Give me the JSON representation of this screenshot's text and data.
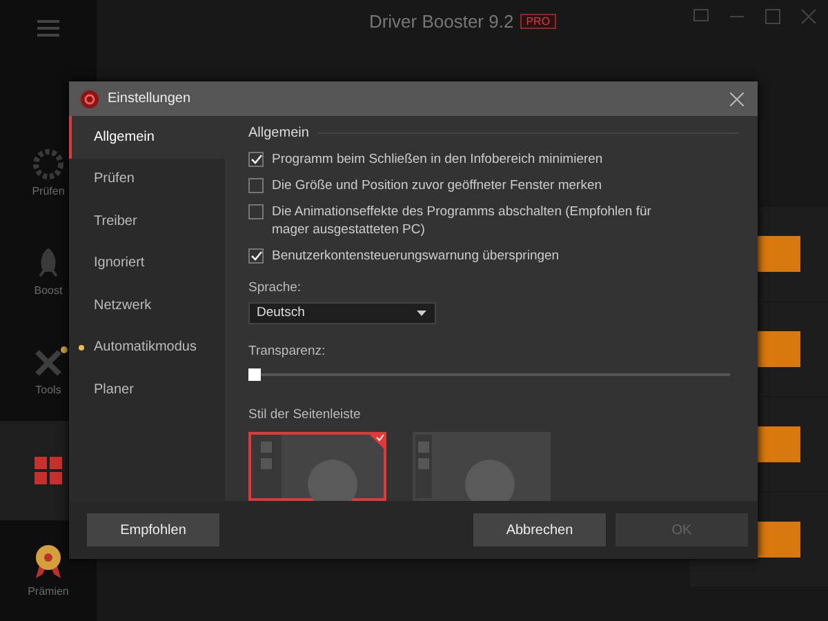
{
  "app": {
    "title": "Driver Booster 9.2",
    "badge": "PRO",
    "sidebar": [
      {
        "kind": "scan",
        "label": "Prüfen",
        "selected": false
      },
      {
        "kind": "boost",
        "label": "Boost",
        "selected": false
      },
      {
        "kind": "tools",
        "label": "Tools",
        "selected": false,
        "notification": true
      },
      {
        "kind": "action",
        "selected": true
      },
      {
        "kind": "rewards",
        "label": "Prämien",
        "selected": false
      }
    ]
  },
  "dialog": {
    "title": "Einstellungen",
    "nav": [
      {
        "label": "Allgemein",
        "selected": true,
        "notification": false
      },
      {
        "label": "Prüfen",
        "selected": false,
        "notification": false
      },
      {
        "label": "Treiber",
        "selected": false,
        "notification": false
      },
      {
        "label": "Ignoriert",
        "selected": false,
        "notification": false
      },
      {
        "label": "Netzwerk",
        "selected": false,
        "notification": false
      },
      {
        "label": "Automatikmodus",
        "selected": false,
        "notification": true
      },
      {
        "label": "Planer",
        "selected": false,
        "notification": false
      }
    ],
    "section": "Allgemein",
    "options": [
      {
        "label": "Programm beim Schließen in den Infobereich minimieren",
        "checked": true
      },
      {
        "label": "Die Größe und Position zuvor geöffneter Fenster merken",
        "checked": false
      },
      {
        "label": "Die Animationseffekte des Programms abschalten (Empfohlen für mager ausgestatteten PC)",
        "checked": false
      },
      {
        "label": "Benutzerkontensteuerungswarnung überspringen",
        "checked": true
      }
    ],
    "language": {
      "label": "Sprache:",
      "value": "Deutsch"
    },
    "transparency": {
      "label": "Transparenz:",
      "level": 0
    },
    "sidebar_style": {
      "label": "Stil der Seitenleiste",
      "styles": [
        {
          "kind": "labeled",
          "selected": true
        },
        {
          "kind": "compact",
          "selected": false
        }
      ]
    },
    "buttons": [
      {
        "label": "Empfohlen",
        "disabled": false
      },
      {
        "label": "Abbrechen",
        "disabled": false
      },
      {
        "label": "OK",
        "disabled": true
      }
    ]
  }
}
